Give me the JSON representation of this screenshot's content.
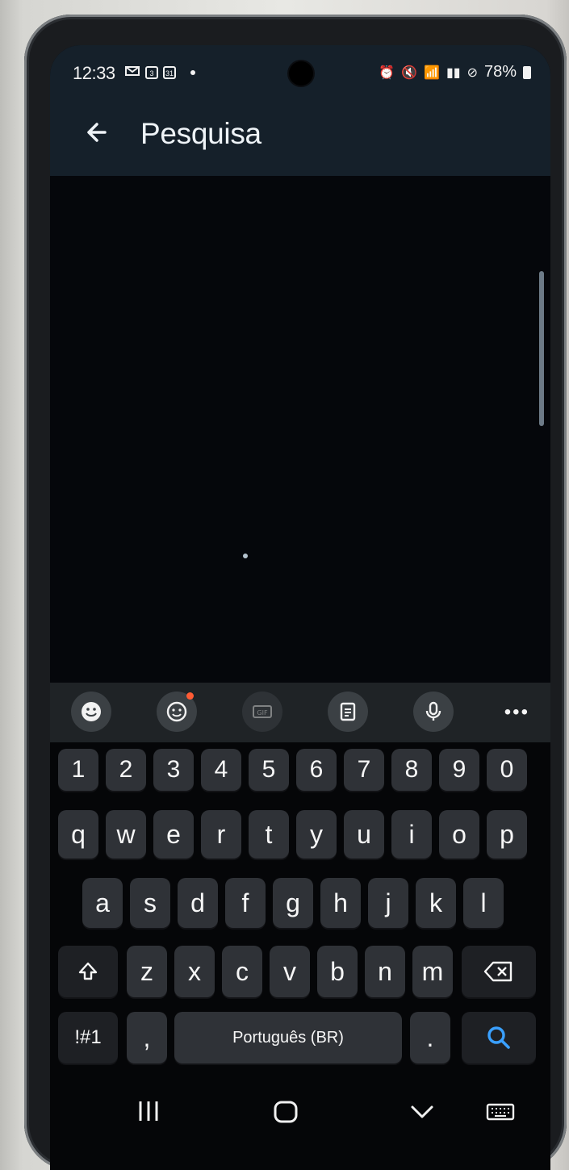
{
  "status_bar": {
    "time": "12:33",
    "left_icons": [
      "gmail-icon",
      "calendar-small-icon",
      "calendar-31-icon",
      "notification-dot"
    ],
    "calendar_small": "3",
    "calendar_31": "31",
    "right_icons": [
      "alarm-icon",
      "mute-icon",
      "wifi-icon",
      "volte-icon",
      "signal-icon",
      "do-not-disturb-icon"
    ],
    "battery": "78%"
  },
  "app_bar": {
    "title": "Pesquisa"
  },
  "keyboard_toolbar": {
    "buttons": [
      "emoji-icon",
      "sticker-icon",
      "gif-icon",
      "clipboard-icon",
      "microphone-icon",
      "more-icon"
    ],
    "more_label": "•••"
  },
  "keyboard": {
    "row_numbers": [
      "1",
      "2",
      "3",
      "4",
      "5",
      "6",
      "7",
      "8",
      "9",
      "0"
    ],
    "row_qwerty": [
      "q",
      "w",
      "e",
      "r",
      "t",
      "y",
      "u",
      "i",
      "o",
      "p"
    ],
    "row_asdf": [
      "a",
      "s",
      "d",
      "f",
      "g",
      "h",
      "j",
      "k",
      "l"
    ],
    "row_zxcv": [
      "z",
      "x",
      "c",
      "v",
      "b",
      "n",
      "m"
    ],
    "symbols_label": "!#1",
    "comma": ",",
    "space_label": "Português (BR)",
    "period": ".",
    "accent_color": "#3aa0ff"
  },
  "navigation_bar": {
    "buttons": [
      "recent-apps-icon",
      "home-icon",
      "back-down-icon",
      "keyboard-switch-icon"
    ]
  }
}
